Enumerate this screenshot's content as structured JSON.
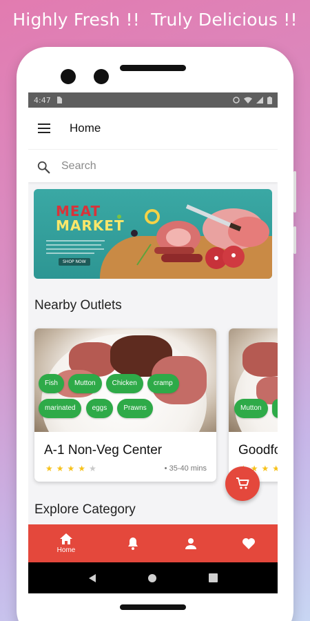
{
  "tagline": "Highly Fresh !!  Truly Delicious !!",
  "status_bar": {
    "time": "4:47"
  },
  "app_bar": {
    "title": "Home"
  },
  "search": {
    "placeholder": "Search"
  },
  "banner": {
    "line1": "MEAT",
    "line2": "MARKET",
    "button": "SHOP NOW"
  },
  "sections": {
    "nearby": "Nearby Outlets",
    "explore": "Explore Category"
  },
  "outlets": [
    {
      "name": "A-1 Non-Veg Center",
      "tags": [
        "Fish",
        "Mutton",
        "Chicken",
        "cramp",
        "marinated",
        "eggs",
        "Prawns"
      ],
      "rating": 4,
      "eta": "• 35-40 mins"
    },
    {
      "name": "Goodfo",
      "tags": [
        "Mutton"
      ],
      "rating": 4
    }
  ],
  "bottom_nav": {
    "items": [
      {
        "label": "Home",
        "icon": "home-icon"
      },
      {
        "icon": "bell-icon"
      },
      {
        "icon": "person-icon"
      },
      {
        "icon": "heart-icon"
      }
    ]
  },
  "colors": {
    "accent": "#e4483c",
    "tag": "#2eaa48",
    "star": "#f7c21b"
  }
}
